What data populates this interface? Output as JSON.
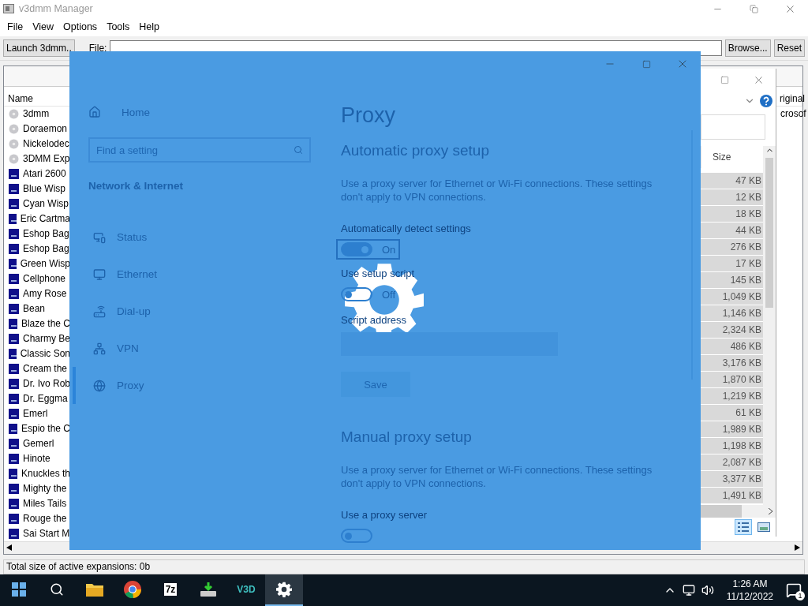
{
  "manager": {
    "title": "v3dmm Manager",
    "menu": [
      "File",
      "View",
      "Options",
      "Tools",
      "Help"
    ],
    "toolbar": {
      "launch_button": "Launch 3dmm..",
      "file_label": "File:",
      "browse_button": "Browse...",
      "reset_button": "Reset"
    },
    "table": {
      "columns": [
        "Name",
        "riginal"
      ],
      "rows": [
        {
          "kind": "disc",
          "name": "3dmm",
          "column_2": "crosof"
        },
        {
          "kind": "disc",
          "name": "Doraemon"
        },
        {
          "kind": "disc",
          "name": "Nickelodec"
        },
        {
          "kind": "disc",
          "name": "3DMM Exp"
        },
        {
          "kind": "package",
          "name": "Atari 2600"
        },
        {
          "kind": "package",
          "name": "Blue Wisp"
        },
        {
          "kind": "package",
          "name": "Cyan Wisp"
        },
        {
          "kind": "package",
          "name": "Eric Cartma"
        },
        {
          "kind": "package",
          "name": "Eshop Bag"
        },
        {
          "kind": "package",
          "name": "Eshop Bag"
        },
        {
          "kind": "package",
          "name": "Green Wisp"
        },
        {
          "kind": "package",
          "name": "Cellphone"
        },
        {
          "kind": "package",
          "name": "Amy Rose"
        },
        {
          "kind": "package",
          "name": "Bean"
        },
        {
          "kind": "package",
          "name": "Blaze the C"
        },
        {
          "kind": "package",
          "name": "Charmy Be"
        },
        {
          "kind": "package",
          "name": "Classic Son"
        },
        {
          "kind": "package",
          "name": "Cream the"
        },
        {
          "kind": "package",
          "name": "Dr. Ivo Rob"
        },
        {
          "kind": "package",
          "name": "Dr. Eggma"
        },
        {
          "kind": "package",
          "name": "Emerl"
        },
        {
          "kind": "package",
          "name": "Espio the C"
        },
        {
          "kind": "package",
          "name": "Gemerl"
        },
        {
          "kind": "package",
          "name": "Hinote"
        },
        {
          "kind": "package",
          "name": "Knuckles th"
        },
        {
          "kind": "package",
          "name": "Mighty the"
        },
        {
          "kind": "package",
          "name": "Miles Tails"
        },
        {
          "kind": "package",
          "name": "Rouge the"
        },
        {
          "kind": "package",
          "name": "Sai Start M"
        }
      ]
    },
    "status_bar": "Total size of active expansions: 0b"
  },
  "file_dialog": {
    "column": "Size",
    "sizes": [
      "47 KB",
      "12 KB",
      "18 KB",
      "44 KB",
      "276 KB",
      "17 KB",
      "145 KB",
      "1,049 KB",
      "1,146 KB",
      "2,324 KB",
      "486 KB",
      "3,176 KB",
      "1,870 KB",
      "1,219 KB",
      "61 KB",
      "1,989 KB",
      "1,198 KB",
      "2,087 KB",
      "3,377 KB",
      "1,491 KB"
    ],
    "views": [
      {
        "kind": "details",
        "selected": true
      },
      {
        "kind": "preview",
        "selected": false
      }
    ]
  },
  "settings": {
    "nav": {
      "home": "Home",
      "search_placeholder": "Find a setting",
      "section": "Network & Internet",
      "items": [
        {
          "kind": "status",
          "label": "Status",
          "selected": false
        },
        {
          "kind": "ethernet",
          "label": "Ethernet",
          "selected": false
        },
        {
          "kind": "dialup",
          "label": "Dial-up",
          "selected": false
        },
        {
          "kind": "vpn",
          "label": "VPN",
          "selected": false
        },
        {
          "kind": "proxy",
          "label": "Proxy",
          "selected": true
        }
      ]
    },
    "page_title": "Proxy",
    "sections": [
      {
        "heading": "Automatic proxy setup",
        "description": "Use a proxy server for Ethernet or Wi-Fi connections. These settings don't apply to VPN connections.",
        "controls": [
          {
            "kind": "toggle",
            "label": "Automatically detect settings",
            "on": true,
            "focused": true,
            "state_text": "On"
          },
          {
            "kind": "toggle",
            "label": "Use setup script",
            "on": false,
            "focused": false,
            "state_text": "Off"
          },
          {
            "kind": "field",
            "label": "Script address"
          },
          {
            "kind": "button",
            "label": "Save"
          }
        ]
      },
      {
        "heading": "Manual proxy setup",
        "description": "Use a proxy server for Ethernet or Wi-Fi connections. These settings don't apply to VPN connections.",
        "controls": [
          {
            "kind": "toggle",
            "label": "Use a proxy server",
            "on": false,
            "focused": false
          }
        ]
      }
    ]
  },
  "taskbar": {
    "apps": [
      {
        "kind": "explorer",
        "active": false
      },
      {
        "kind": "chrome",
        "active": false
      },
      {
        "kind": "sevenzip",
        "label": "7z",
        "active": false
      },
      {
        "kind": "drive",
        "active": false
      },
      {
        "kind": "v3d",
        "label": "V3D",
        "active": false
      },
      {
        "kind": "settings",
        "active": true
      }
    ],
    "time": "1:26 AM",
    "date": "11/12/2022",
    "notifications": "1"
  }
}
